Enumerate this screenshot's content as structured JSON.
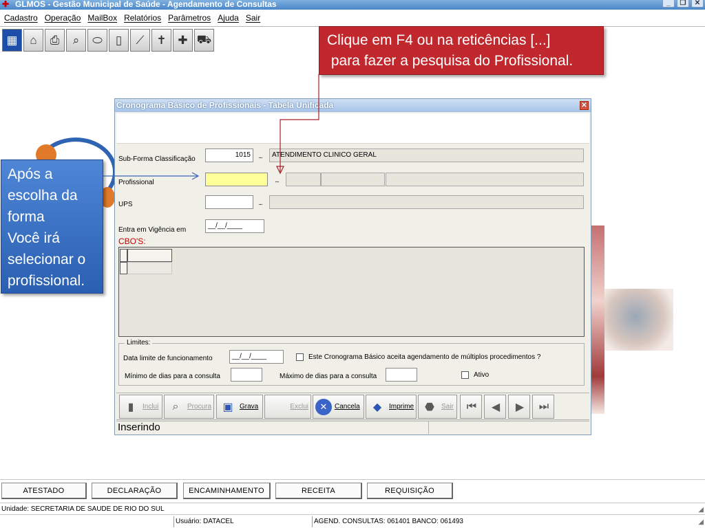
{
  "window": {
    "title": "GLMOS - Gestão Municipal de Saúde - Agendamento de Consultas"
  },
  "menu": [
    "Cadastro",
    "Operação",
    "MailBox",
    "Relatórios",
    "Parâmetros",
    "Ajuda",
    "Sair"
  ],
  "toolbar_icons": [
    "calendar-icon",
    "building-icon",
    "printer-icon",
    "magnifier-icon",
    "pill-icon",
    "clipboard-icon",
    "syringe-icon",
    "cross-icon",
    "medical-bag-icon",
    "ambulance-icon"
  ],
  "callouts": {
    "top": "Clique em F4 ou na reticências [...]\n para fazer a pesquisa do Profissional.",
    "left": "Após a\nescolha da\nforma\nVocê irá\nselecionar o\nprofissional."
  },
  "dialog": {
    "title": "Cronograma Básico de Profissionais - Tabela Unificada",
    "subforma_label": "Sub-Forma Classificação",
    "subforma_code": "1015",
    "subforma_desc": "ATENDIMENTO CLINICO GERAL",
    "profissional_label": "Profissional",
    "ups_label": "UPS",
    "vigencia_label": "Entra em Vigência em",
    "vigencia_value": "__/__/____",
    "ellipsis": "...",
    "cbos_label": "CBO'S:",
    "limits": {
      "legend": "Limites:",
      "data_limite_label": "Data limite de funcionamento",
      "data_limite_value": "__/__/____",
      "multiplos_label": "Este Cronograma Básico aceita agendamento de múltiplos procedimentos ?",
      "minimo_label": "Mínimo de dias para  a consulta",
      "maximo_label": "Máximo de dias para a consulta",
      "ativo_label": "Ativo"
    },
    "buttons": {
      "inclui": "Inclui",
      "procura": "Procura",
      "grava": "Grava",
      "exclui": "Exclui",
      "cancela": "Cancela",
      "imprime": "Imprime",
      "sair": "Sair"
    },
    "status": "Inserindo"
  },
  "bottom_buttons": [
    "ATESTADO",
    "DECLARAÇÃO",
    "ENCAMINHAMENTO",
    "RECEITA",
    "REQUISIÇÃO"
  ],
  "unidade": "Unidade: SECRETARIA DE SAUDE DE RIO DO SUL",
  "statusbar": {
    "usuario": "Usuário: DATACEL",
    "agend": "AGEND. CONSULTAS: 061401 BANCO: 061493"
  },
  "colors": {
    "callout_red": "#c0282d",
    "callout_blue": "#2a5fb1",
    "highlight_field": "#ffff99"
  }
}
